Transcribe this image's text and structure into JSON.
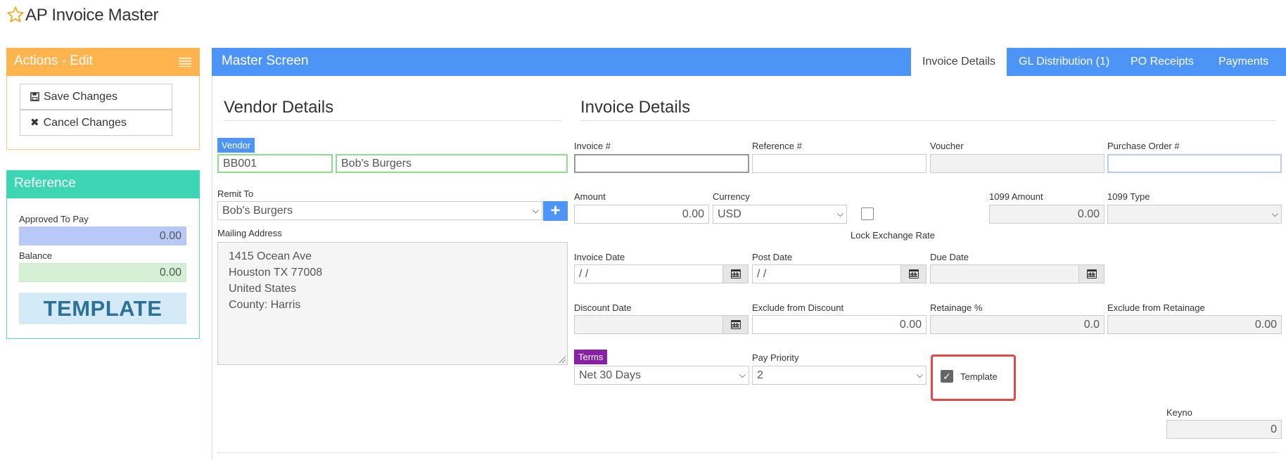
{
  "page": {
    "title": "AP Invoice Master"
  },
  "actions": {
    "header": "Actions - Edit",
    "save_label": "Save Changes",
    "cancel_label": "Cancel Changes"
  },
  "reference": {
    "header": "Reference",
    "approved_label": "Approved To Pay",
    "approved_value": "0.00",
    "balance_label": "Balance",
    "balance_value": "0.00",
    "template_banner": "TEMPLATE"
  },
  "master": {
    "title": "Master Screen",
    "tabs": [
      {
        "label": "Invoice Details",
        "active": true
      },
      {
        "label": "GL Distribution (1)",
        "active": false
      },
      {
        "label": "PO Receipts",
        "active": false
      },
      {
        "label": "Payments",
        "active": false
      }
    ]
  },
  "vendor": {
    "section_title": "Vendor Details",
    "vendor_tag": "Vendor",
    "vendor_code": "BB001",
    "vendor_name": "Bob's Burgers",
    "remit_label": "Remit To",
    "remit_value": "Bob's Burgers",
    "plus_label": "+",
    "mailing_label": "Mailing Address",
    "mailing_lines": [
      "1415 Ocean Ave",
      "Houston TX  77008",
      "United States",
      "County: Harris"
    ]
  },
  "invoice": {
    "section_title": "Invoice Details",
    "invoice_no_label": "Invoice #",
    "invoice_no_value": "",
    "reference_label": "Reference #",
    "reference_value": "",
    "voucher_label": "Voucher",
    "voucher_value": "",
    "po_label": "Purchase Order #",
    "po_value": "",
    "amount_label": "Amount",
    "amount_value": "0.00",
    "currency_label": "Currency",
    "currency_value": "USD",
    "lock_label": "Lock Exchange Rate",
    "amount1099_label": "1099 Amount",
    "amount1099_value": "0.00",
    "type1099_label": "1099 Type",
    "type1099_value": "",
    "invoice_date_label": "Invoice Date",
    "invoice_date_value": " /  /",
    "post_date_label": "Post Date",
    "post_date_value": " /  /",
    "due_date_label": "Due Date",
    "due_date_value": "",
    "discount_date_label": "Discount Date",
    "discount_date_value": "",
    "excl_discount_label": "Exclude from Discount",
    "excl_discount_value": "0.00",
    "retainage_label": "Retainage %",
    "retainage_value": "0.0",
    "excl_retainage_label": "Exclude from Retainage",
    "excl_retainage_value": "0.00",
    "terms_tag": "Terms",
    "terms_value": "Net 30 Days",
    "pay_priority_label": "Pay Priority",
    "pay_priority_value": "2",
    "template_checkbox_label": "Template",
    "keyno_label": "Keyno",
    "keyno_value": "0"
  },
  "colors": {
    "actions_header": "#ffb44d",
    "reference_header": "#3dd6b5",
    "master_bar": "#4d94f7",
    "vendor_tag": "#4d94f7",
    "terms_tag": "#8a1fa8",
    "highlight": "#e8474a",
    "template_banner_bg": "#d4eaf7",
    "template_banner_text": "#2d7196"
  }
}
